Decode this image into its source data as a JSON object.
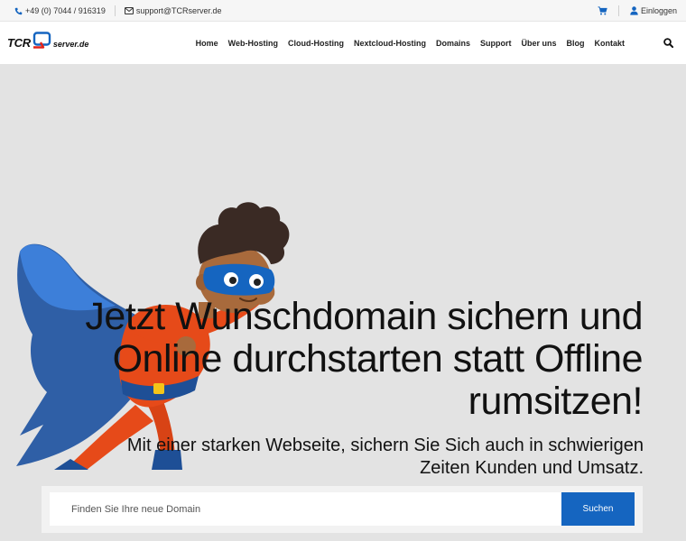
{
  "topbar": {
    "phone": "+49 (0) 7044 / 916319",
    "email": "support@TCRserver.de",
    "login": "Einloggen"
  },
  "logo": {
    "brand": "TCR",
    "domain": "server.de"
  },
  "nav": {
    "items": [
      "Home",
      "Web-Hosting",
      "Cloud-Hosting",
      "Nextcloud-Hosting",
      "Domains",
      "Support",
      "Über uns",
      "Blog",
      "Kontakt"
    ]
  },
  "hero": {
    "headline_lines": [
      "Jetzt Wunschdomain sichern und",
      "Online durchstarten statt Offline",
      "rumsitzen!"
    ],
    "subline_lines": [
      "Mit einer starken Webseite, sichern Sie Sich auch in schwierigen",
      "Zeiten Kunden und Umsatz."
    ]
  },
  "domain_search": {
    "placeholder": "Finden Sie Ihre neue Domain",
    "button_label": "Suchen"
  },
  "colors": {
    "accent_blue": "#1565c0",
    "logo_red": "#e2231a",
    "hero_background": "#e3e3e3"
  }
}
